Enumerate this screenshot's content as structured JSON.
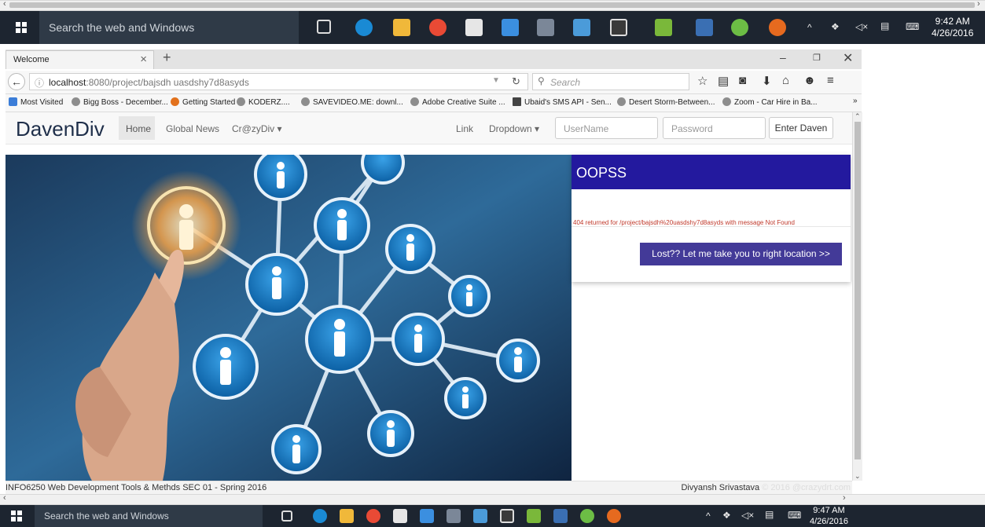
{
  "taskbar": {
    "search_placeholder": "Search the web and Windows",
    "time": "9:42 AM",
    "date": "4/26/2016"
  },
  "taskbar_bottom": {
    "search_placeholder": "Search the web and Windows",
    "time": "9:47 AM",
    "date": "4/26/2016"
  },
  "browser": {
    "tab_title": "Welcome",
    "url_host": "localhost",
    "url_rest": ":8080/project/bajsdh uasdshy7d8asyds",
    "search_placeholder": "Search",
    "bookmarks": [
      "Most Visited",
      "Bigg Boss - December...",
      "Getting Started",
      "KODERZ....",
      "SAVEVIDEO.ME: downl...",
      "Adobe Creative Suite ...",
      "Ubaid's SMS API - Sen...",
      "Desert Storm-Between...",
      "Zoom - Car Hire in Ba..."
    ]
  },
  "site": {
    "brand": "DavenDiv",
    "nav": {
      "home": "Home",
      "global_news": "Global News",
      "crazy_div": "Cr@zyDiv ▾",
      "link": "Link",
      "dropdown": "Dropdown ▾"
    },
    "username_placeholder": "UserName",
    "password_placeholder": "Password",
    "enter_button": "Enter Daven"
  },
  "error_panel": {
    "title": "OOPSS",
    "message": "404 returned for /project/bajsdh%20uasdshy7d8asyds with message Not Found",
    "button": "Lost?? Let me take you to right location >>"
  },
  "footer": {
    "left": "INFO6250 Web Development Tools & Methds SEC 01 - Spring 2016",
    "author": "Divyansh Srivastava",
    "copyright": "© 2016 @crazydrt.com"
  },
  "colors": {
    "taskbar": "#1d2530",
    "panel_header": "#23199e",
    "lost_button": "#433a98",
    "error_text": "#c0392b"
  }
}
